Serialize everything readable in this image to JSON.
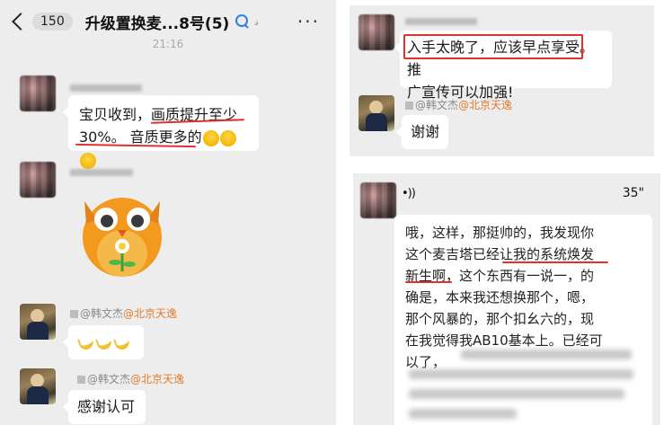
{
  "panel1": {
    "back_count": "150",
    "title": "升级置换麦...8号(5)",
    "time": "21:16",
    "messages": [
      {
        "text_plain": "宝贝收到，",
        "text_ul1": "画质提升至少",
        "text_ul2": "30%。 音质更多的",
        "emoji_count": 3
      },
      {
        "nick": "@韩文杰",
        "loc": "@北京天逸"
      },
      {
        "nick2": "@韩文杰",
        "loc2": "@北京天逸",
        "text": "感谢认可"
      }
    ]
  },
  "panel2": {
    "line1": "入手太晚了，应该早点享受。",
    "line1_suffix": "推",
    "line2": "广宣传可以加强!",
    "nick": "@韩文杰",
    "loc": "@北京天逸",
    "reply": "谢谢"
  },
  "panel3": {
    "duration": "35\"",
    "lines": [
      "哦，这样，那挺帅的，我发现你",
      "这个麦吉塔已经让我的系统焕发",
      "新生啊，这个东西有一说一，的",
      "确是，本来我还想换那个，嗯，",
      "那个风暴的，那个扣幺六的，现",
      "在我觉得我AB10基本上。已经可",
      "以了，"
    ]
  }
}
